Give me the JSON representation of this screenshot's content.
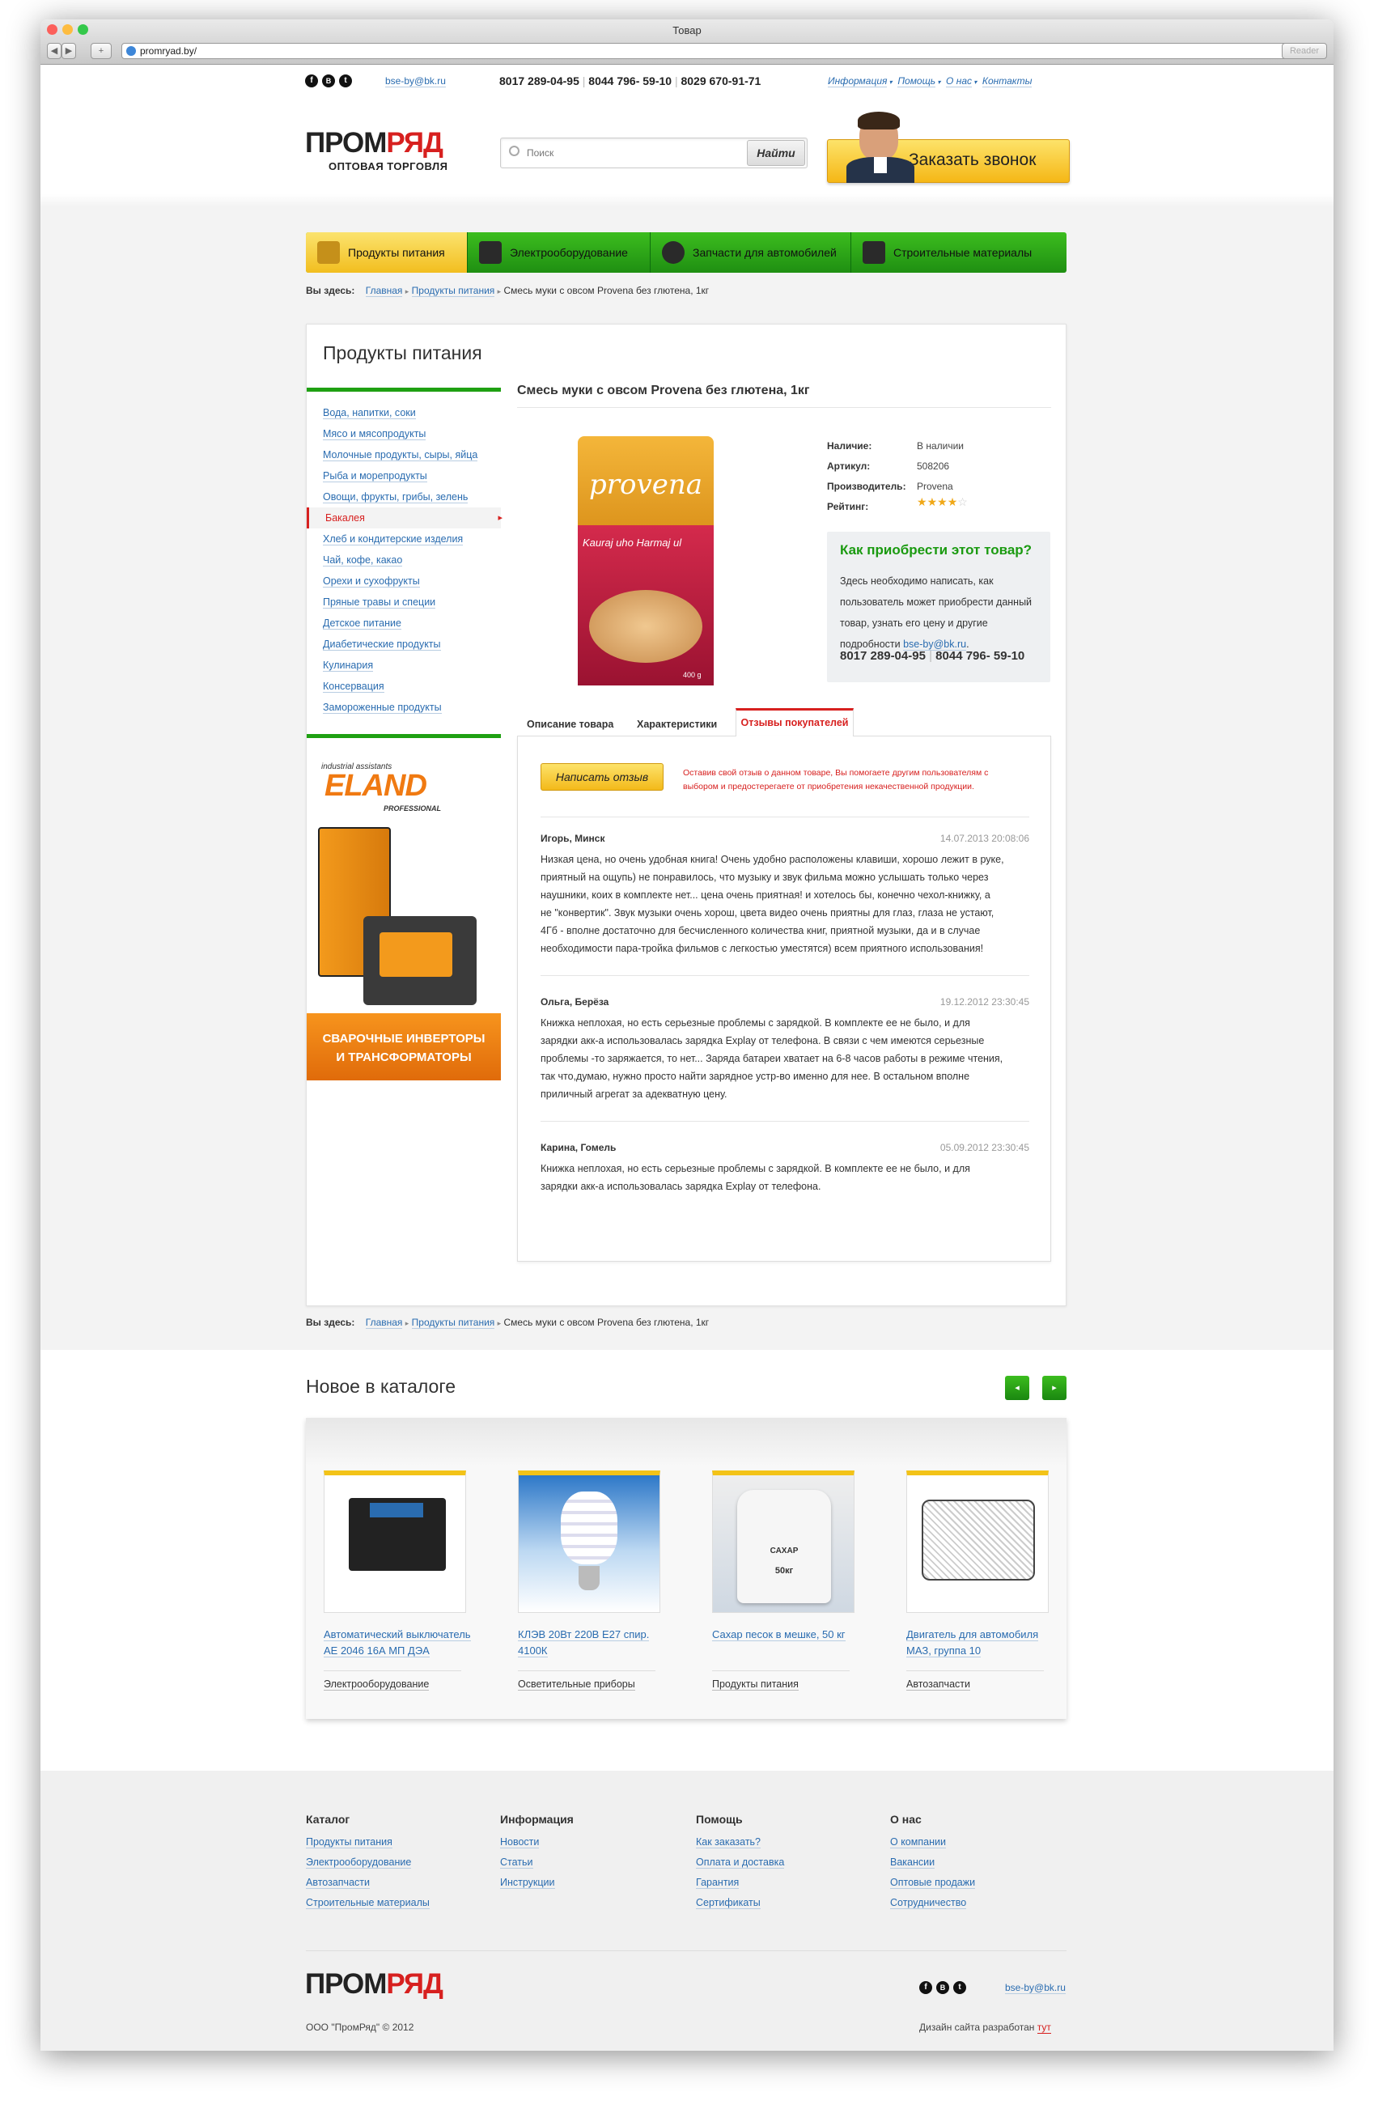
{
  "window": {
    "title": "Товар",
    "url": "promryad.by/",
    "reader": "Reader"
  },
  "topbar": {
    "email": "bse-by@bk.ru",
    "phones": [
      "8017 289-04-95",
      "8044 796- 59-10",
      "8029 670-91-71"
    ],
    "menu": [
      "Информация",
      "Помощь",
      "О нас",
      "Контакты"
    ],
    "social": [
      "f",
      "B",
      "t"
    ]
  },
  "header": {
    "logo_a": "ПРОМ",
    "logo_b": "РЯД",
    "tagline": "ОПТОВАЯ ТОРГОВЛЯ",
    "search_placeholder": "Поиск",
    "search_button": "Найти",
    "callback": "Заказать звонок"
  },
  "nav": [
    "Продукты питания",
    "Электрооборудование",
    "Запчасти для автомобилей",
    "Строительные материалы"
  ],
  "breadcrumb": {
    "label": "Вы здесь:",
    "items": [
      "Главная",
      "Продукты питания",
      "Смесь муки с овсом Provena без глютена, 1кг"
    ]
  },
  "section_title": "Продукты питания",
  "categories": [
    "Вода, напитки, соки",
    "Мясо и мясопродукты",
    "Молочные продукты, сыры, яйца",
    "Рыба и морепродукты",
    "Овощи, фрукты, грибы, зелень",
    "Бакалея",
    "Хлеб и кондитерские изделия",
    "Чай, кофе, какао",
    "Орехи и сухофрукты",
    "Пряные травы и специи",
    "Детское питание",
    "Диабетические продукты",
    "Кулинария",
    "Консервация",
    "Замороженные продукты"
  ],
  "banner": {
    "brand": "ELAND",
    "brand_top": "industrial assistants",
    "brand_sub": "PROFESSIONAL",
    "caption_1": "СВАРОЧНЫЕ ИНВЕРТОРЫ",
    "caption_2": "И ТРАНСФОРМАТОРЫ"
  },
  "product": {
    "title": "Смесь муки с овсом Provena без глютена, 1кг",
    "package_brand": "provena",
    "package_line": "Kauraj uho Harmaj ul",
    "weight": "400 g",
    "specs": [
      {
        "k": "Наличие:",
        "v": "В наличии"
      },
      {
        "k": "Артикул:",
        "v": "508206"
      },
      {
        "k": "Производитель:",
        "v": "Provena"
      },
      {
        "k": "Рейтинг:",
        "v": ""
      }
    ],
    "rating": 4,
    "buy": {
      "title": "Как приобрести этот товар?",
      "text": "Здесь необходимо написать, как пользователь может приобрести данный товар, узнать его цену и другие подробности ",
      "email": "bse-by@bk.ru",
      "phone1": "8017 289-04-95",
      "phone2": "8044 796- 59-10"
    }
  },
  "tabs": [
    "Описание товара",
    "Характеристики",
    "Отзывы покупателей"
  ],
  "review_box": {
    "button": "Написать отзыв",
    "hint": "Оставив свой отзыв о данном товаре, Вы помогаете другим пользователям с выбором и предостерегаете от приобретения некачественной продукции."
  },
  "reviews": [
    {
      "name": "Игорь, Минск",
      "date": "14.07.2013 20:08:06",
      "lines": [
        "Низкая цена, но очень удобная книга! Очень удобно расположены клавиши, хорошо лежит в руке,",
        "приятный на ощупь) не понравилось, что музыку и звук фильма можно услышать только через",
        "наушники, коих в комплекте нет... цена очень приятная! и хотелось бы, конечно чехол-книжку, а",
        "не \"конвертик\". Звук музыки очень хорош, цвета видео очень приятны для глаз, глаза не устают,",
        "4Гб - вполне достаточно для бесчисленного количества книг, приятной музыки, да и в случае",
        "необходимости пара-тройка фильмов с легкостью уместятся) всем приятного использования!"
      ]
    },
    {
      "name": "Ольга, Берёза",
      "date": "19.12.2012 23:30:45",
      "lines": [
        "Книжка неплохая, но есть серьезные проблемы с зарядкой. В комплекте ее не было, и для",
        "зарядки акк-а использовалась зарядка Explay от телефона. В связи с чем имеются серьезные",
        "проблемы -то заряжается, то нет... Заряда батареи хватает на 6-8 часов работы в режиме чтения,",
        "так что,думаю, нужно просто найти зарядное устр-во именно для нее. В остальном вполне",
        "приличный агрегат за адекватную цену."
      ]
    },
    {
      "name": "Карина, Гомель",
      "date": "05.09.2012 23:30:45",
      "lines": [
        "Книжка неплохая, но есть серьезные проблемы с зарядкой. В комплекте ее не было, и для",
        "зарядки акк-а использовалась зарядка Explay от телефона."
      ]
    }
  ],
  "catalog": {
    "title": "Новое в каталоге",
    "items": [
      {
        "title_1": "Автоматический выключатель",
        "title_2": "АЕ 2046 16А МП ДЭА",
        "category": "Электрооборудование"
      },
      {
        "title_1": "КЛЭВ 20Вт 220В Е27 спир. 4100К",
        "title_2": "",
        "category": "Осветительные приборы"
      },
      {
        "title_1": "Сахар песок в мешке, 50 кг",
        "title_2": "",
        "category": "Продукты питания",
        "bag_label": "САХАР",
        "bag_weight": "50кг"
      },
      {
        "title_1": "Двигатель для автомобиля",
        "title_2": "МАЗ, группа 10",
        "category": "Автозапчасти"
      }
    ]
  },
  "footer": {
    "cols": [
      {
        "title": "Каталог",
        "links": [
          "Продукты питания",
          "Электрооборудование",
          "Автозапчасти",
          "Строительные материалы"
        ]
      },
      {
        "title": "Информация",
        "links": [
          "Новости",
          "Статьи",
          "Инструкции"
        ]
      },
      {
        "title": "Помощь",
        "links": [
          "Как заказать?",
          "Оплата и доставка",
          "Гарантия",
          "Сертификаты"
        ]
      },
      {
        "title": "О нас",
        "links": [
          "О компании",
          "Вакансии",
          "Оптовые продажи",
          "Сотрудничество"
        ]
      }
    ],
    "copyright": "ООО \"ПромРяд\" © 2012",
    "design": "Дизайн сайта  разработан ",
    "design_link": "тут",
    "email": "bse-by@bk.ru"
  }
}
